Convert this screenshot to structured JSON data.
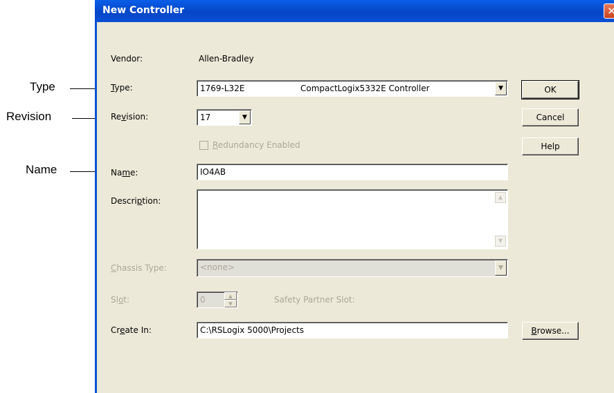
{
  "callouts": {
    "type": "Type",
    "revision": "Revision",
    "name": "Name"
  },
  "dialog": {
    "title": "New Controller",
    "close_glyph": "✕"
  },
  "form": {
    "vendor_label": "Vendor:",
    "vendor_value": "Allen-Bradley",
    "type_label_pre": "",
    "type_label_acc": "T",
    "type_label_post": "ype:",
    "type_code": "1769-L32E",
    "type_desc": "CompactLogix5332E Controller",
    "revision_label_pre": "Re",
    "revision_label_acc": "v",
    "revision_label_post": "ision:",
    "revision_value": "17",
    "redundancy_pre": "",
    "redundancy_acc": "R",
    "redundancy_post": "edundancy Enabled",
    "name_label_pre": "Na",
    "name_label_acc": "m",
    "name_label_post": "e:",
    "name_value": "IO4AB",
    "description_label_pre": "Descri",
    "description_label_acc": "p",
    "description_label_post": "tion:",
    "description_value": "",
    "chassis_label_pre": "",
    "chassis_label_acc": "C",
    "chassis_label_post": "hassis Type:",
    "chassis_value": "<none>",
    "slot_label_pre": "Sl",
    "slot_label_acc": "o",
    "slot_label_post": "t:",
    "slot_value": "0",
    "safety_partner_label": "Safety Partner Slot:",
    "create_in_label_pre": "Cr",
    "create_in_label_acc": "e",
    "create_in_label_post": "ate In:",
    "create_in_value": "C:\\RSLogix 5000\\Projects"
  },
  "buttons": {
    "ok": "OK",
    "cancel": "Cancel",
    "help": "Help",
    "browse_acc": "B",
    "browse_post": "rowse..."
  },
  "icons": {
    "dropdown_arrow": "▼",
    "scroll_up": "▲",
    "scroll_down": "▼",
    "spin_up": "▲",
    "spin_down": "▼"
  }
}
